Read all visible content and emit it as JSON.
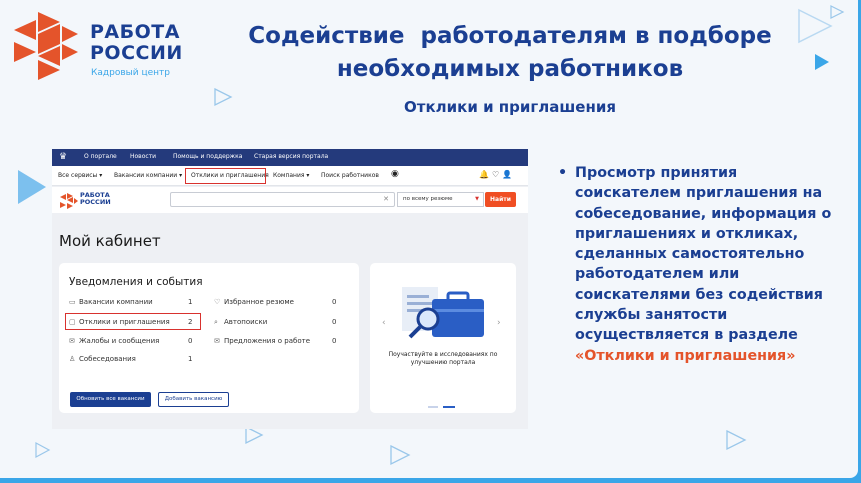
{
  "logo": {
    "line1": "РАБОТА",
    "line2": "РОССИИ",
    "tagline": "Кадровый центр"
  },
  "title": {
    "line1": "Содействие  работодателям в подборе",
    "line2": "необходимых работников"
  },
  "subtitle": "Отклики и приглашения",
  "screenshot": {
    "topbar": [
      "О портале",
      "Новости",
      "Помощь и поддержка",
      "Старая версия портала"
    ],
    "nav": [
      "Все сервисы",
      "Вакансии компании",
      "Отклики и приглашения",
      "Компания",
      "Поиск работников"
    ],
    "header": {
      "logo_line1": "РАБОТА",
      "logo_line2": "РОССИИ",
      "search_scope": "по всему резюме",
      "find_button": "Найти"
    },
    "cabinet_title": "Мой кабинет",
    "notifications": {
      "heading": "Уведомления и события",
      "left": [
        {
          "icon": "briefcase-icon",
          "label": "Вакансии компании",
          "count": "1"
        },
        {
          "icon": "chat-icon",
          "label": "Отклики и приглашения",
          "count": "2"
        },
        {
          "icon": "mail-icon",
          "label": "Жалобы и сообщения",
          "count": "0"
        },
        {
          "icon": "people-icon",
          "label": "Собеседования",
          "count": "1"
        }
      ],
      "right": [
        {
          "icon": "heart-icon",
          "label": "Избранное резюме",
          "count": "0"
        },
        {
          "icon": "search-icon",
          "label": "Автопоиски",
          "count": "0"
        },
        {
          "icon": "mail-icon",
          "label": "Предложения о работе",
          "count": "0"
        }
      ],
      "update_button": "Обновить все вакансии",
      "add_button": "Добавить вакансию"
    },
    "promo": {
      "caption_line1": "Поучаствуйте в исследованиях по",
      "caption_line2": "улучшению портала"
    }
  },
  "bullet": {
    "text": "Просмотр принятия соискателем приглашения на собеседование,  информация о приглашениях и откликах, сделанных самостоятельно работодателем или соискателями без содействия службы занятости осуществляется в разделе",
    "highlight": "«Отклики и приглашения»"
  },
  "colors": {
    "brand_blue": "#1b3f92",
    "accent_red": "#e4542b",
    "light_blue": "#3aa6e8"
  }
}
